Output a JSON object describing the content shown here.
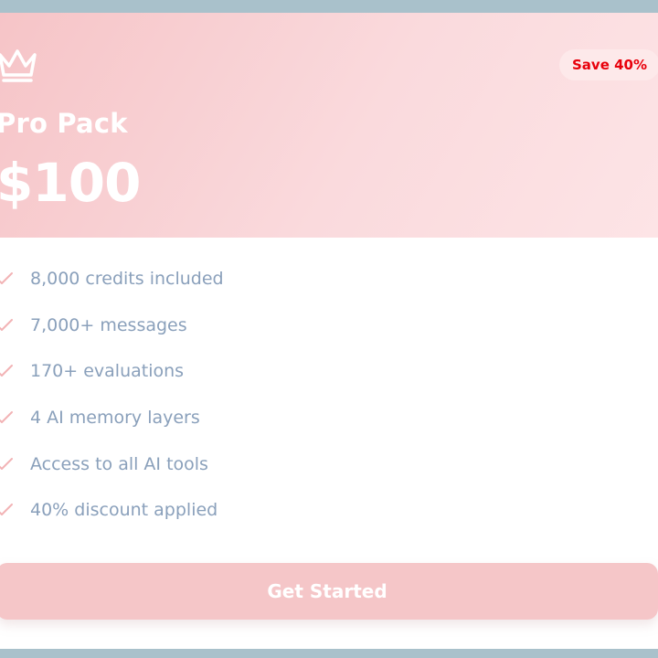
{
  "plan": {
    "name": "Pro Pack",
    "price": "$100",
    "badge": "Save 40%"
  },
  "features": [
    {
      "text": "8,000 credits included"
    },
    {
      "text": "7,000+ messages"
    },
    {
      "text": "170+ evaluations"
    },
    {
      "text": "4 AI memory layers"
    },
    {
      "text": "Access to all AI tools"
    },
    {
      "text": "40% discount applied"
    }
  ],
  "cta": {
    "label": "Get Started"
  },
  "icons": {
    "header": "crown-icon",
    "feature": "check-icon"
  },
  "colors": {
    "header_gradient_start": "#f6c4c7",
    "header_gradient_end": "#fde4e6",
    "badge_text": "#e8000b",
    "feature_text": "#8aa0bb",
    "check": "#f2b3b5",
    "button": "#f5c6c8",
    "frame_strip": "#a9c1cb"
  }
}
